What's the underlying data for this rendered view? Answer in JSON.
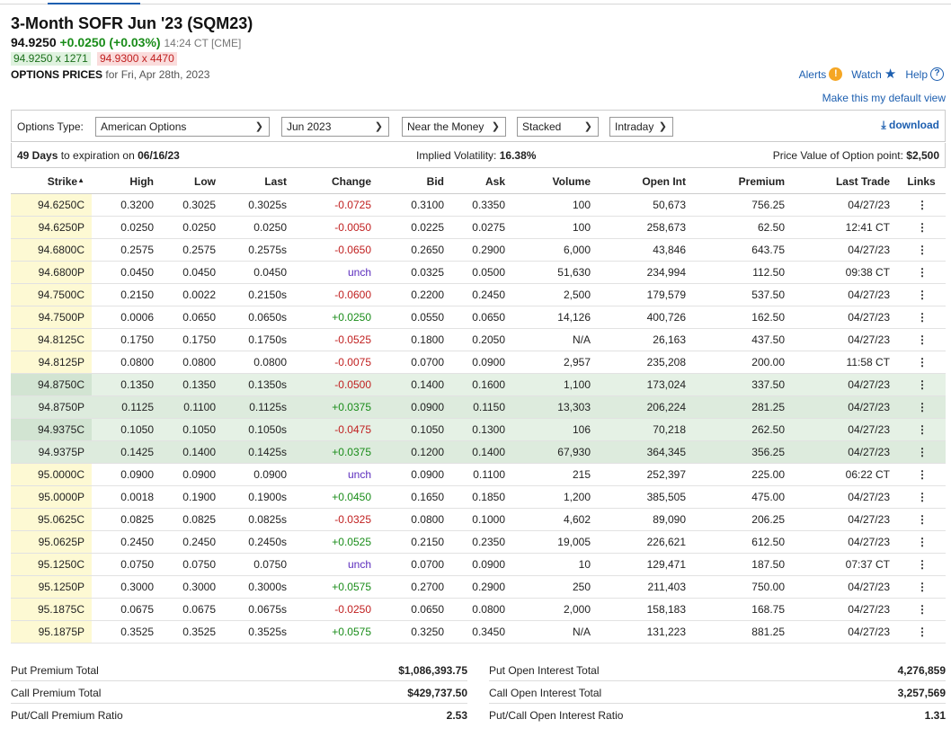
{
  "header": {
    "title": "3-Month SOFR Jun '23 (SQM23)",
    "last": "94.9250",
    "change": "+0.0250 (+0.03%)",
    "time": "14:24 CT [CME]",
    "bid": "94.9250 x 1271",
    "ask": "94.9300 x 4470",
    "options_prices_label": "OPTIONS PRICES",
    "options_prices_date": "for Fri, Apr 28th, 2023"
  },
  "toplinks": {
    "alerts": "Alerts",
    "watch": "Watch",
    "help": "Help"
  },
  "default_view": "Make this my default view",
  "filters": {
    "options_type_label": "Options Type:",
    "options_type": "American Options",
    "expiration": "Jun 2023",
    "moneyness": "Near the Money",
    "layout": "Stacked",
    "period": "Intraday",
    "download": "download"
  },
  "info": {
    "days_bold": "49 Days",
    "days_text": "to expiration on",
    "expiry_date": "06/16/23",
    "iv_label": "Implied Volatility:",
    "iv_value": "16.38%",
    "pv_label": "Price Value of Option point:",
    "pv_value": "$2,500"
  },
  "columns": [
    "Strike",
    "High",
    "Low",
    "Last",
    "Change",
    "Bid",
    "Ask",
    "Volume",
    "Open Int",
    "Premium",
    "Last Trade",
    "Links"
  ],
  "rows": [
    {
      "strike": "94.6250C",
      "high": "0.3200",
      "low": "0.3025",
      "last": "0.3025s",
      "change": "-0.0725",
      "bid": "0.3100",
      "ask": "0.3350",
      "volume": "100",
      "oi": "50,673",
      "premium": "756.25",
      "trade": "04/27/23"
    },
    {
      "strike": "94.6250P",
      "high": "0.0250",
      "low": "0.0250",
      "last": "0.0250",
      "change": "-0.0050",
      "bid": "0.0225",
      "ask": "0.0275",
      "volume": "100",
      "oi": "258,673",
      "premium": "62.50",
      "trade": "12:41 CT"
    },
    {
      "strike": "94.6800C",
      "high": "0.2575",
      "low": "0.2575",
      "last": "0.2575s",
      "change": "-0.0650",
      "bid": "0.2650",
      "ask": "0.2900",
      "volume": "6,000",
      "oi": "43,846",
      "premium": "643.75",
      "trade": "04/27/23"
    },
    {
      "strike": "94.6800P",
      "high": "0.0450",
      "low": "0.0450",
      "last": "0.0450",
      "change": "unch",
      "bid": "0.0325",
      "ask": "0.0500",
      "volume": "51,630",
      "oi": "234,994",
      "premium": "112.50",
      "trade": "09:38 CT"
    },
    {
      "strike": "94.7500C",
      "high": "0.2150",
      "low": "0.0022",
      "last": "0.2150s",
      "change": "-0.0600",
      "bid": "0.2200",
      "ask": "0.2450",
      "volume": "2,500",
      "oi": "179,579",
      "premium": "537.50",
      "trade": "04/27/23"
    },
    {
      "strike": "94.7500P",
      "high": "0.0006",
      "low": "0.0650",
      "last": "0.0650s",
      "change": "+0.0250",
      "bid": "0.0550",
      "ask": "0.0650",
      "volume": "14,126",
      "oi": "400,726",
      "premium": "162.50",
      "trade": "04/27/23"
    },
    {
      "strike": "94.8125C",
      "high": "0.1750",
      "low": "0.1750",
      "last": "0.1750s",
      "change": "-0.0525",
      "bid": "0.1800",
      "ask": "0.2050",
      "volume": "N/A",
      "oi": "26,163",
      "premium": "437.50",
      "trade": "04/27/23"
    },
    {
      "strike": "94.8125P",
      "high": "0.0800",
      "low": "0.0800",
      "last": "0.0800",
      "change": "-0.0075",
      "bid": "0.0700",
      "ask": "0.0900",
      "volume": "2,957",
      "oi": "235,208",
      "premium": "200.00",
      "trade": "11:58 CT"
    },
    {
      "strike": "94.8750C",
      "high": "0.1350",
      "low": "0.1350",
      "last": "0.1350s",
      "change": "-0.0500",
      "bid": "0.1400",
      "ask": "0.1600",
      "volume": "1,100",
      "oi": "173,024",
      "premium": "337.50",
      "trade": "04/27/23"
    },
    {
      "strike": "94.8750P",
      "high": "0.1125",
      "low": "0.1100",
      "last": "0.1125s",
      "change": "+0.0375",
      "bid": "0.0900",
      "ask": "0.1150",
      "volume": "13,303",
      "oi": "206,224",
      "premium": "281.25",
      "trade": "04/27/23"
    },
    {
      "strike": "94.9375C",
      "high": "0.1050",
      "low": "0.1050",
      "last": "0.1050s",
      "change": "-0.0475",
      "bid": "0.1050",
      "ask": "0.1300",
      "volume": "106",
      "oi": "70,218",
      "premium": "262.50",
      "trade": "04/27/23"
    },
    {
      "strike": "94.9375P",
      "high": "0.1425",
      "low": "0.1400",
      "last": "0.1425s",
      "change": "+0.0375",
      "bid": "0.1200",
      "ask": "0.1400",
      "volume": "67,930",
      "oi": "364,345",
      "premium": "356.25",
      "trade": "04/27/23"
    },
    {
      "strike": "95.0000C",
      "high": "0.0900",
      "low": "0.0900",
      "last": "0.0900",
      "change": "unch",
      "bid": "0.0900",
      "ask": "0.1100",
      "volume": "215",
      "oi": "252,397",
      "premium": "225.00",
      "trade": "06:22 CT"
    },
    {
      "strike": "95.0000P",
      "high": "0.0018",
      "low": "0.1900",
      "last": "0.1900s",
      "change": "+0.0450",
      "bid": "0.1650",
      "ask": "0.1850",
      "volume": "1,200",
      "oi": "385,505",
      "premium": "475.00",
      "trade": "04/27/23"
    },
    {
      "strike": "95.0625C",
      "high": "0.0825",
      "low": "0.0825",
      "last": "0.0825s",
      "change": "-0.0325",
      "bid": "0.0800",
      "ask": "0.1000",
      "volume": "4,602",
      "oi": "89,090",
      "premium": "206.25",
      "trade": "04/27/23"
    },
    {
      "strike": "95.0625P",
      "high": "0.2450",
      "low": "0.2450",
      "last": "0.2450s",
      "change": "+0.0525",
      "bid": "0.2150",
      "ask": "0.2350",
      "volume": "19,005",
      "oi": "226,621",
      "premium": "612.50",
      "trade": "04/27/23"
    },
    {
      "strike": "95.1250C",
      "high": "0.0750",
      "low": "0.0750",
      "last": "0.0750",
      "change": "unch",
      "bid": "0.0700",
      "ask": "0.0900",
      "volume": "10",
      "oi": "129,471",
      "premium": "187.50",
      "trade": "07:37 CT"
    },
    {
      "strike": "95.1250P",
      "high": "0.3000",
      "low": "0.3000",
      "last": "0.3000s",
      "change": "+0.0575",
      "bid": "0.2700",
      "ask": "0.2900",
      "volume": "250",
      "oi": "211,403",
      "premium": "750.00",
      "trade": "04/27/23"
    },
    {
      "strike": "95.1875C",
      "high": "0.0675",
      "low": "0.0675",
      "last": "0.0675s",
      "change": "-0.0250",
      "bid": "0.0650",
      "ask": "0.0800",
      "volume": "2,000",
      "oi": "158,183",
      "premium": "168.75",
      "trade": "04/27/23"
    },
    {
      "strike": "95.1875P",
      "high": "0.3525",
      "low": "0.3525",
      "last": "0.3525s",
      "change": "+0.0575",
      "bid": "0.3250",
      "ask": "0.3450",
      "volume": "N/A",
      "oi": "131,223",
      "premium": "881.25",
      "trade": "04/27/23"
    }
  ],
  "totals_left": [
    {
      "label": "Put Premium Total",
      "value": "$1,086,393.75"
    },
    {
      "label": "Call Premium Total",
      "value": "$429,737.50"
    },
    {
      "label": "Put/Call Premium Ratio",
      "value": "2.53"
    }
  ],
  "totals_right": [
    {
      "label": "Put Open Interest Total",
      "value": "4,276,859"
    },
    {
      "label": "Call Open Interest Total",
      "value": "3,257,569"
    },
    {
      "label": "Put/Call Open Interest Ratio",
      "value": "1.31"
    }
  ],
  "colors": {
    "positive": "#198c19",
    "negative": "#c01f1f",
    "unchanged": "#5a2bbd",
    "link": "#1d5fb0",
    "strike_bg": "#fdf9d3",
    "in_the_money_bg": "#e5f1e5"
  }
}
